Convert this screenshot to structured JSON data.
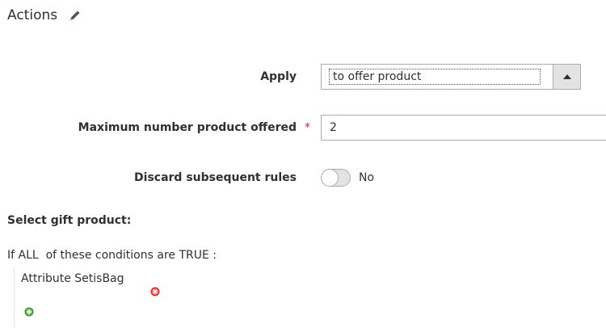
{
  "section": {
    "title": "Actions"
  },
  "apply": {
    "label": "Apply",
    "selected": "to offer product"
  },
  "max_offered": {
    "label": "Maximum number product offered",
    "required_mark": "*",
    "value": "2"
  },
  "discard": {
    "label": "Discard subsequent rules",
    "state": "No",
    "on": false
  },
  "gift": {
    "heading": "Select gift product:",
    "condition_if": "If",
    "aggregator": "ALL",
    "condition_middle": "of these conditions are",
    "value": "TRUE",
    "condition_end": ":",
    "rule": {
      "attribute": "Attribute Set",
      "operator": "is",
      "value": "Bag"
    }
  },
  "colors": {
    "required": "#e22626",
    "remove_icon": "#e22626",
    "add_icon": "#3a8f2a"
  },
  "icons": {
    "edit": "pencil-icon",
    "remove": "remove-icon",
    "add": "add-icon",
    "select_arrow": "triangle-up-icon"
  }
}
